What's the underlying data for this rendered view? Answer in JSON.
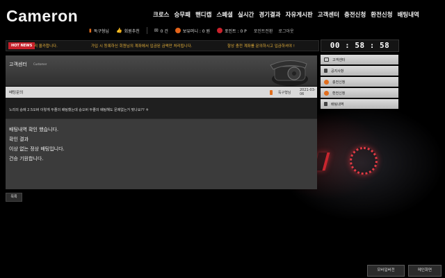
{
  "header": {
    "logo": "Cameron",
    "nav": [
      "크로스",
      "승무패",
      "핸디캡",
      "스페셜",
      "실시간",
      "경기결과",
      "자유게시판",
      "고객센터",
      "충전신청",
      "환전신청",
      "배팅내역"
    ]
  },
  "userbar": {
    "username": "독구형님",
    "recommend": "회원추천",
    "messages": "0 건",
    "money": "보유머니 : 0 원",
    "points": "포인트 : 0 P",
    "convert": "포인트전환",
    "logout": "로그아웃"
  },
  "ticker": {
    "badge": "HOT NEWS",
    "messages": [
      "리 올카합니다.",
      "가입 시 등록하신 회원님의 계좌에서 입금된 금액만 처리됩니다.",
      "항상 충전 계좌를 문의하시고 입금하셔야 !"
    ]
  },
  "timer": "00 : 58 : 58",
  "panel": {
    "title": "고객센터",
    "subtitle": "Customer"
  },
  "post": {
    "title": "배팅문의",
    "author": "독구형님",
    "date": "2021-03-06",
    "question": "노리의 승에 2.5오버 이렇게 두줄의 배팅했는데 승오버 두줄의 배팅해도 문제없는거 맞나요?? ㅎ",
    "answer_lines": [
      "배팅내역 확인 했습니다.",
      "확인 결과",
      "이상 없는 정상 배팅입니다.",
      "건승 기원합니다."
    ]
  },
  "list_button": "목록",
  "sidebar": [
    "고객센터",
    "공지사항",
    "충전신청",
    "환전신청",
    "배팅내역"
  ],
  "bottom": {
    "mobile": "모바일버전",
    "pc": "메인화면"
  }
}
